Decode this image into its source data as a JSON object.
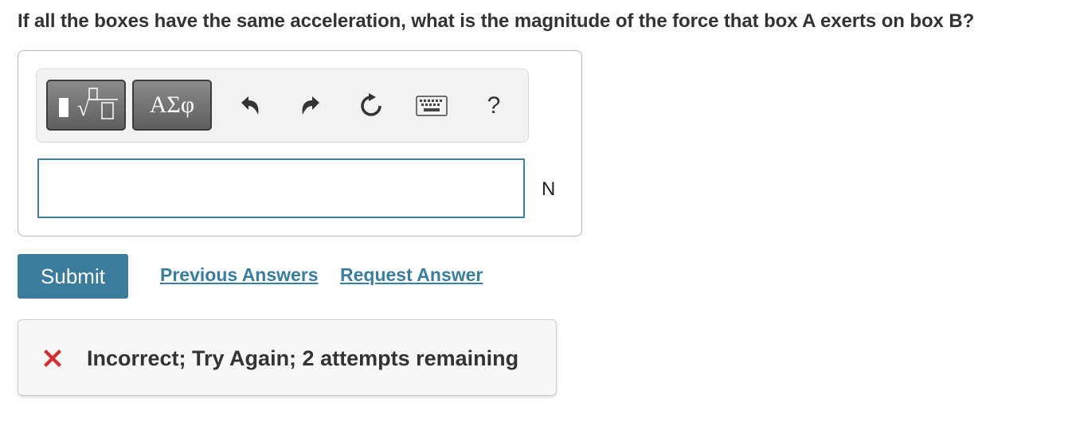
{
  "question": {
    "text": "If all the boxes have the same acceleration, what is the magnitude of the force that box A exerts on box B?"
  },
  "toolbar": {
    "template_button_icon": "templates-root-icon",
    "greek_button_label": "ΑΣφ",
    "undo_icon": "undo-icon",
    "redo_icon": "redo-icon",
    "reset_icon": "reset-icon",
    "keyboard_icon": "keyboard-icon",
    "help_label": "?"
  },
  "answer": {
    "value": "",
    "unit": "N"
  },
  "actions": {
    "submit_label": "Submit",
    "previous_answers_label": "Previous Answers",
    "request_answer_label": "Request Answer"
  },
  "feedback": {
    "status_icon": "x-icon",
    "message": "Incorrect; Try Again; 2 attempts remaining"
  },
  "colors": {
    "accent": "#3b7b9b",
    "link": "#3a7d9f",
    "error": "#d32f2f",
    "input_border": "#3a7f9c"
  }
}
